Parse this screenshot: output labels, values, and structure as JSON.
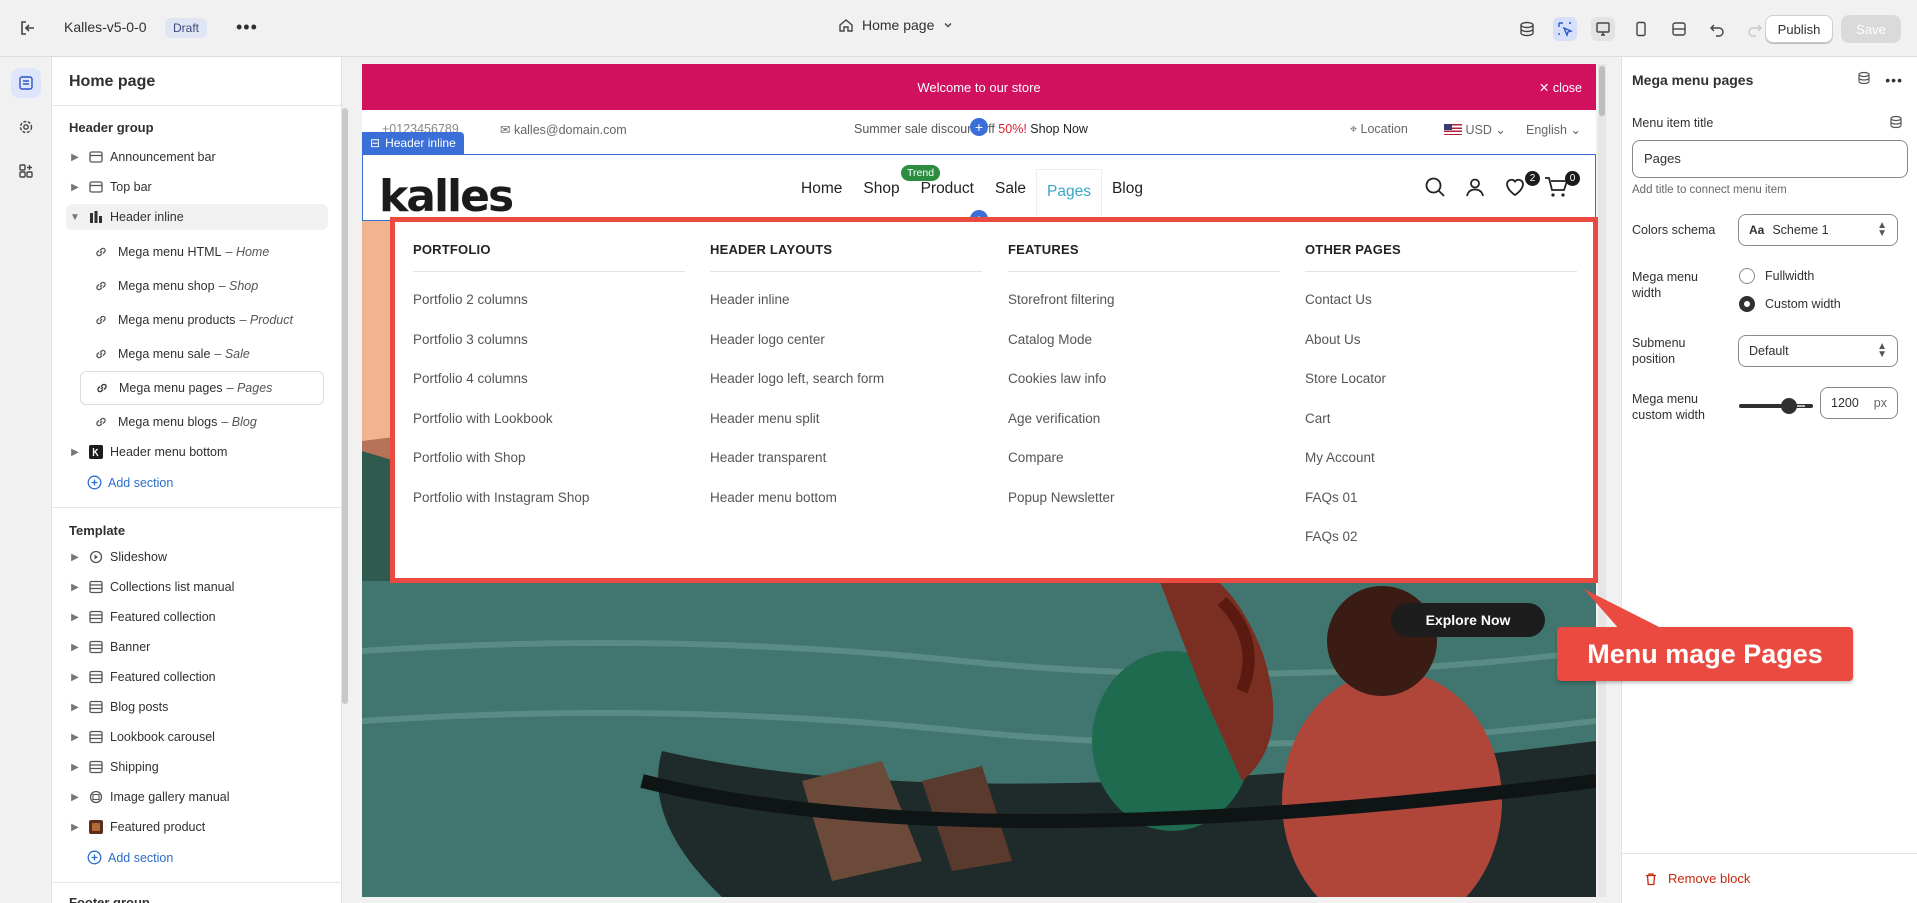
{
  "topbar": {
    "theme_name": "Kalles-v5-0-0",
    "status_badge": "Draft",
    "more": "•••",
    "page_selector": "Home page",
    "publish_label": "Publish",
    "save_label": "Save"
  },
  "sidebar": {
    "title": "Home page",
    "header_group_label": "Header group",
    "header_items": [
      "Announcement bar",
      "Top bar",
      "Header inline"
    ],
    "mega_items": [
      {
        "label": "Mega menu HTML",
        "target": "– Home"
      },
      {
        "label": "Mega menu shop",
        "target": "– Shop"
      },
      {
        "label": "Mega menu products",
        "target": "– Product"
      },
      {
        "label": "Mega menu sale",
        "target": "– Sale"
      },
      {
        "label": "Mega menu pages",
        "target": "– Pages"
      },
      {
        "label": "Mega menu blogs",
        "target": "– Blog"
      }
    ],
    "header_menu_bottom": "Header menu bottom",
    "add_section": "Add section",
    "template_label": "Template",
    "template_items": [
      "Slideshow",
      "Collections list manual",
      "Featured collection",
      "Banner",
      "Featured collection",
      "Blog posts",
      "Lookbook carousel",
      "Shipping",
      "Image gallery manual",
      "Featured product"
    ],
    "add_section_2": "Add section",
    "footer_group_label": "Footer group"
  },
  "preview": {
    "announcement": "Welcome to our store",
    "close_label": "close",
    "phone": "+0123456789",
    "email": "kalles@domain.com",
    "promo_prefix": "Summer sale discount off",
    "promo_pct": "50%!",
    "promo_link": "Shop Now",
    "location": "Location",
    "currency": "USD",
    "language": "English",
    "header_tag": "Header inline",
    "logo": "kalles",
    "nav": [
      "Home",
      "Shop",
      "Product",
      "Sale",
      "Pages",
      "Blog"
    ],
    "trend_badge": "Trend",
    "wishlist_count": "2",
    "cart_count": "0",
    "explore_label": "Explore Now"
  },
  "mega_menu": {
    "columns": [
      {
        "heading": "PORTFOLIO",
        "links": [
          "Portfolio 2 columns",
          "Portfolio 3 columns",
          "Portfolio 4 columns",
          "Portfolio with Lookbook",
          "Portfolio with Shop",
          "Portfolio with Instagram Shop"
        ]
      },
      {
        "heading": "HEADER LAYOUTS",
        "links": [
          "Header inline",
          "Header logo center",
          "Header logo left, search form",
          "Header menu split",
          "Header transparent",
          "Header menu bottom"
        ]
      },
      {
        "heading": "FEATURES",
        "links": [
          "Storefront filtering",
          "Catalog Mode",
          "Cookies law info",
          "Age verification",
          "Compare",
          "Popup Newsletter"
        ]
      },
      {
        "heading": "OTHER PAGES",
        "links": [
          "Contact Us",
          "About Us",
          "Store Locator",
          "Cart",
          "My Account",
          "FAQs 01",
          "FAQs 02"
        ]
      }
    ]
  },
  "callout": "Menu mage Pages",
  "panel": {
    "title": "Mega menu pages",
    "menu_item_title_label": "Menu item title",
    "menu_item_title_value": "Pages",
    "menu_item_hint": "Add title to connect menu item",
    "colors_schema_label": "Colors schema",
    "colors_schema_value": "Scheme 1",
    "mega_width_label": "Mega menu width",
    "width_options": [
      "Fullwidth",
      "Custom width"
    ],
    "width_selected": "Custom width",
    "submenu_label": "Submenu position",
    "submenu_value": "Default",
    "custom_width_label": "Mega menu custom width",
    "custom_width_value": "1200",
    "custom_width_unit": "px",
    "remove_label": "Remove block"
  },
  "colors": {
    "announcement_bg": "#d1105e",
    "accent_blue": "#3a6fd8",
    "highlight_red": "#ea4a3f",
    "nav_active": "#38a8c8"
  }
}
